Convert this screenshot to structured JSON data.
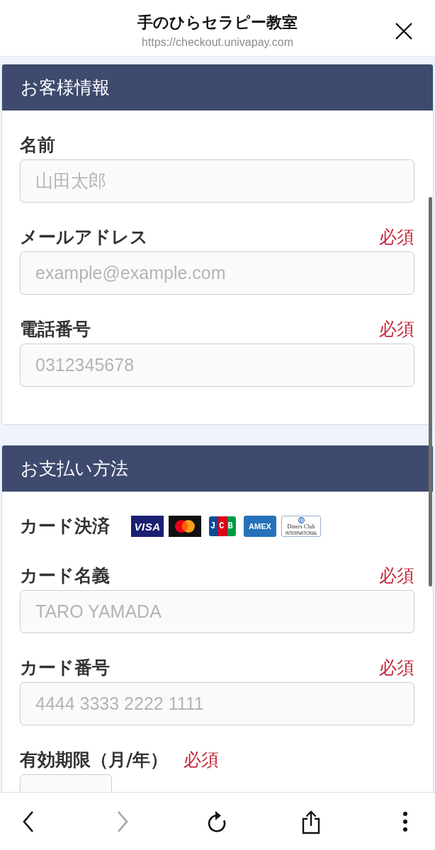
{
  "browser_header": {
    "title": "手のひらセラピー教室",
    "url": "https://checkout.univapay.com"
  },
  "sections": [
    {
      "title": "お客様情報",
      "fields": [
        {
          "kind": "text",
          "label": "名前",
          "placeholder": "山田太郎"
        },
        {
          "kind": "text",
          "label": "メールアドレス",
          "required_text": "必須",
          "placeholder": "example@example.com"
        },
        {
          "kind": "text",
          "label": "電話番号",
          "required_text": "必須",
          "placeholder": "0312345678"
        }
      ]
    },
    {
      "title": "お支払い方法",
      "fields": [
        {
          "kind": "card_brands",
          "label": "カード決済",
          "brands": [
            {
              "kind": "visa",
              "text": "VISA"
            },
            {
              "kind": "mastercard"
            },
            {
              "kind": "jcb",
              "text": "JCB"
            },
            {
              "kind": "amex",
              "text": "AMEX"
            },
            {
              "kind": "diners",
              "text": "Diners Club",
              "subtext": "INTERNATIONAL"
            }
          ]
        },
        {
          "kind": "text",
          "label": "カード名義",
          "required_text": "必須",
          "placeholder": "TARO YAMADA"
        },
        {
          "kind": "text",
          "label": "カード番号",
          "required_text": "必須",
          "placeholder": "4444 3333 2222 1111"
        },
        {
          "kind": "short",
          "label": "有効期限（月/年）",
          "required_text": "必須"
        }
      ]
    }
  ],
  "toolbar": [
    {
      "kind": "back",
      "disabled": false
    },
    {
      "kind": "forward",
      "disabled": true
    },
    {
      "kind": "reload",
      "disabled": false
    },
    {
      "kind": "share",
      "disabled": false
    },
    {
      "kind": "more",
      "disabled": false
    }
  ]
}
